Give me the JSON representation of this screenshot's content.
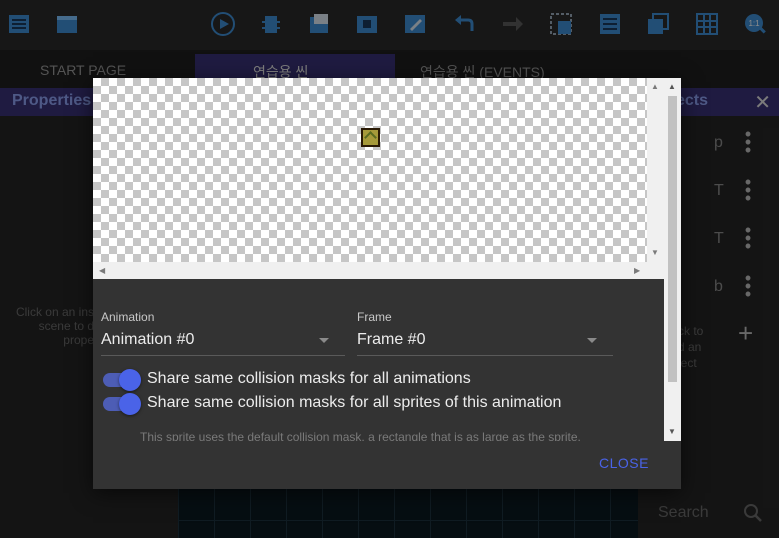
{
  "toolbar": {
    "icons": [
      "project-manager-icon",
      "scene-editor-icon",
      "preview-play-icon",
      "debug-icon",
      "add-instance-icon",
      "add-object-icon",
      "edit-icon",
      "undo-icon",
      "redo-icon",
      "select-area-icon",
      "layers-list-icon",
      "window-icon",
      "grid-icon",
      "zoom-reset-icon"
    ],
    "zoom_label": "1:1"
  },
  "tabs": [
    {
      "label": "START PAGE",
      "active": false
    },
    {
      "label": "연습용 씬",
      "active": true
    },
    {
      "label": "연습용 씬 (EVENTS)",
      "active": false
    }
  ],
  "left_panel": {
    "title": "Properties",
    "hint": "Click on an ins\nscene to d\nprope"
  },
  "right_panel": {
    "title": "ects",
    "objects": [
      "p",
      "T",
      "T",
      "b"
    ],
    "hint": "ck to\nd an\nject",
    "search_label": "Search"
  },
  "dialog": {
    "animation_label": "Animation",
    "animation_value": "Animation #0",
    "frame_label": "Frame",
    "frame_value": "Frame #0",
    "toggle1_label": "Share same collision masks for all animations",
    "toggle1_on": true,
    "toggle2_label": "Share same collision masks for all sprites of this animation",
    "toggle2_on": true,
    "info_text": "This sprite uses the default collision mask, a rectangle that is as large as the sprite.",
    "close_label": "CLOSE"
  },
  "colors": {
    "accent": "#4a63e8",
    "panel_header": "#3a3277",
    "panel_title": "#8ea3f5"
  }
}
